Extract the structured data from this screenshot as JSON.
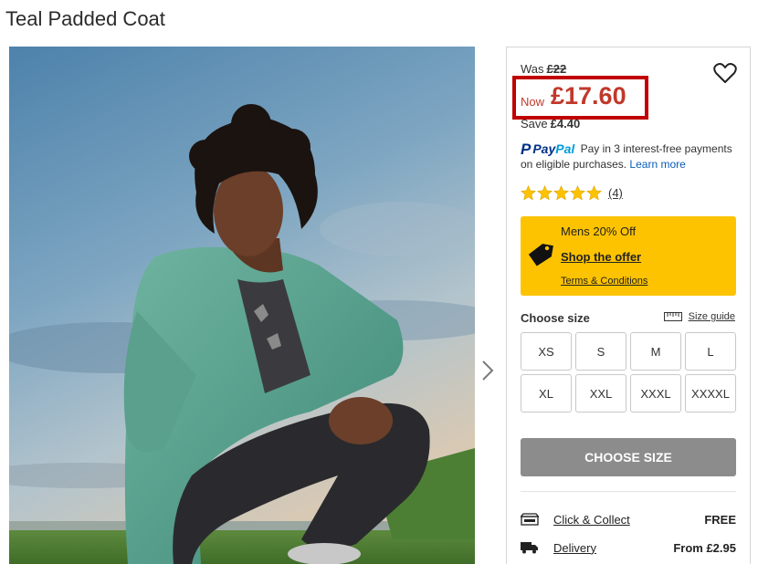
{
  "product": {
    "title": "Teal Padded Coat"
  },
  "price": {
    "was_label": "Was",
    "was_value": "£22",
    "now_label": "Now",
    "now_value": "£17.60",
    "save_label": "Save",
    "save_value": "£4.40"
  },
  "paypal": {
    "logo_pay": "Pay",
    "logo_pal": "Pal",
    "text": "Pay in 3 interest-free payments on eligible purchases.",
    "learn_more": "Learn more"
  },
  "rating": {
    "stars": 5,
    "count": "(4)"
  },
  "offer": {
    "title": "Mens 20% Off",
    "link": "Shop the offer",
    "terms": "Terms & Conditions",
    "color": "#fec300"
  },
  "sizes": {
    "label": "Choose size",
    "guide": "Size guide",
    "options": [
      "XS",
      "S",
      "M",
      "L",
      "XL",
      "XXL",
      "XXXL",
      "XXXXL"
    ]
  },
  "cta": {
    "choose_size": "CHOOSE SIZE"
  },
  "shipping": [
    {
      "icon": "store-icon",
      "label": "Click & Collect",
      "price": "FREE"
    },
    {
      "icon": "truck-icon",
      "label": "Delivery",
      "price": "From £2.95"
    }
  ],
  "colors": {
    "sale_red": "#c0392b",
    "highlight_border": "#c00000",
    "button_grey": "#8c8c8c"
  }
}
